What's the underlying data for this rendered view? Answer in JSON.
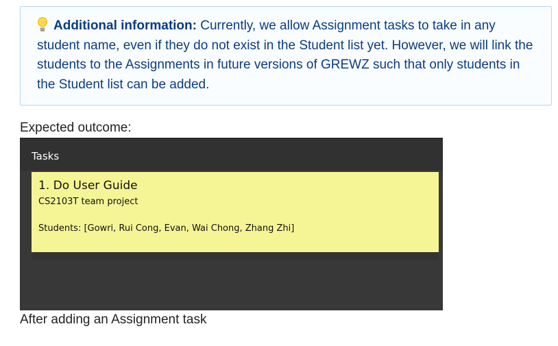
{
  "info_box": {
    "icon": "lightbulb-icon",
    "bold_label": "Additional information:",
    "text": " Currently, we allow Assignment tasks to take in any student name, even if they do not exist in the Student list yet. However, we will link the students to the Assignments in future versions of GREWZ such that only students in the Student list can be added."
  },
  "expected_label": "Expected outcome:",
  "screenshot": {
    "panel_title": "Tasks",
    "task": {
      "title": "1.  Do User Guide",
      "description": "CS2103T team project",
      "students": "Students: [Gowri, Rui Cong, Evan, Wai Chong, Zhang Zhi]"
    },
    "colors": {
      "panel_bg": "#383838",
      "card_bg": "#f5f596"
    }
  },
  "caption": "After adding an Assignment task"
}
